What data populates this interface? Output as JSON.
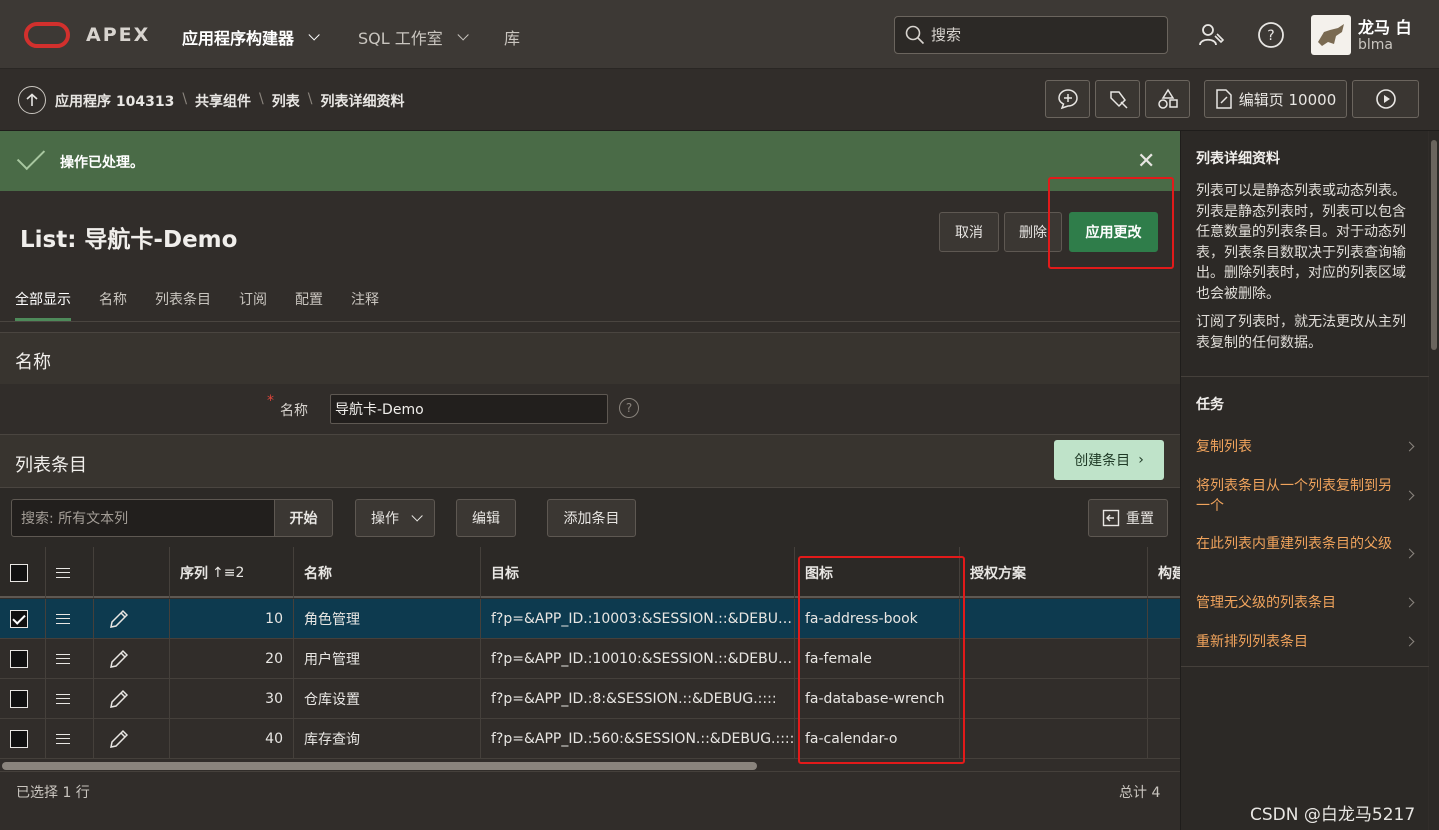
{
  "topbar": {
    "brand": "APEX",
    "nav": [
      {
        "label": "应用程序构建器",
        "active": true
      },
      {
        "label": "SQL 工作室",
        "active": false
      },
      {
        "label": "库",
        "active": false
      }
    ],
    "search_placeholder": "搜索",
    "user_name": "龙马 白",
    "user_id": "blma"
  },
  "breadcrumb": {
    "items": [
      "应用程序 104313",
      "共享组件",
      "列表",
      "列表详细资料"
    ],
    "edit_page_label": "编辑页 10000"
  },
  "alert": {
    "message": "操作已处理。",
    "color": "#4a6b47"
  },
  "page": {
    "title": "List: 导航卡-Demo",
    "buttons": {
      "cancel": "取消",
      "delete": "删除",
      "apply": "应用更改"
    },
    "tabs": [
      "全部显示",
      "名称",
      "列表条目",
      "订阅",
      "配置",
      "注释"
    ]
  },
  "name_region": {
    "title": "名称",
    "field_label": "名称",
    "field_value": "导航卡-Demo"
  },
  "entries_region": {
    "title": "列表条目",
    "create_button": "创建条目",
    "search_placeholder": "搜索: 所有文本列",
    "go": "开始",
    "actions": "操作",
    "edit": "编辑",
    "add_row": "添加条目",
    "reset": "重置",
    "columns": {
      "seq": "序列",
      "seq_sort": "↑≡2",
      "name": "名称",
      "target": "目标",
      "icon": "图标",
      "auth": "授权方案",
      "build": "构建"
    },
    "rows": [
      {
        "seq": "10",
        "name": "角色管理",
        "target": "f?p=&APP_ID.:10003:&SESSION.::&DEBU…",
        "icon": "fa-address-book",
        "selected": true
      },
      {
        "seq": "20",
        "name": "用户管理",
        "target": "f?p=&APP_ID.:10010:&SESSION.::&DEBU…",
        "icon": "fa-female",
        "selected": false
      },
      {
        "seq": "30",
        "name": "仓库设置",
        "target": "f?p=&APP_ID.:8:&SESSION.::&DEBUG.::::",
        "icon": "fa-database-wrench",
        "selected": false
      },
      {
        "seq": "40",
        "name": "库存查询",
        "target": "f?p=&APP_ID.:560:&SESSION.::&DEBUG.::::",
        "icon": "fa-calendar-o",
        "selected": false
      }
    ],
    "footer_selected": "已选择 1 行",
    "footer_total": "总计 4"
  },
  "help_panel": {
    "title": "列表详细资料",
    "paragraph1": "列表可以是静态列表或动态列表。列表是静态列表时，列表可以包含任意数量的列表条目。对于动态列表，列表条目数取决于列表查询输出。删除列表时，对应的列表区域也会被删除。",
    "paragraph2": "订阅了列表时，就无法更改从主列表复制的任何数据。",
    "tasks_title": "任务",
    "tasks": [
      "复制列表",
      "将列表条目从一个列表复制到另一个",
      "在此列表内重建列表条目的父级",
      "管理无父级的列表条目",
      "重新排列列表条目"
    ]
  },
  "watermark": "CSDN @白龙马5217",
  "colors": {
    "accent_green": "#2f7d4a",
    "highlight_red": "#e21a1a",
    "link_orange": "#f0a35c",
    "selected_row": "#0d3a4f"
  }
}
